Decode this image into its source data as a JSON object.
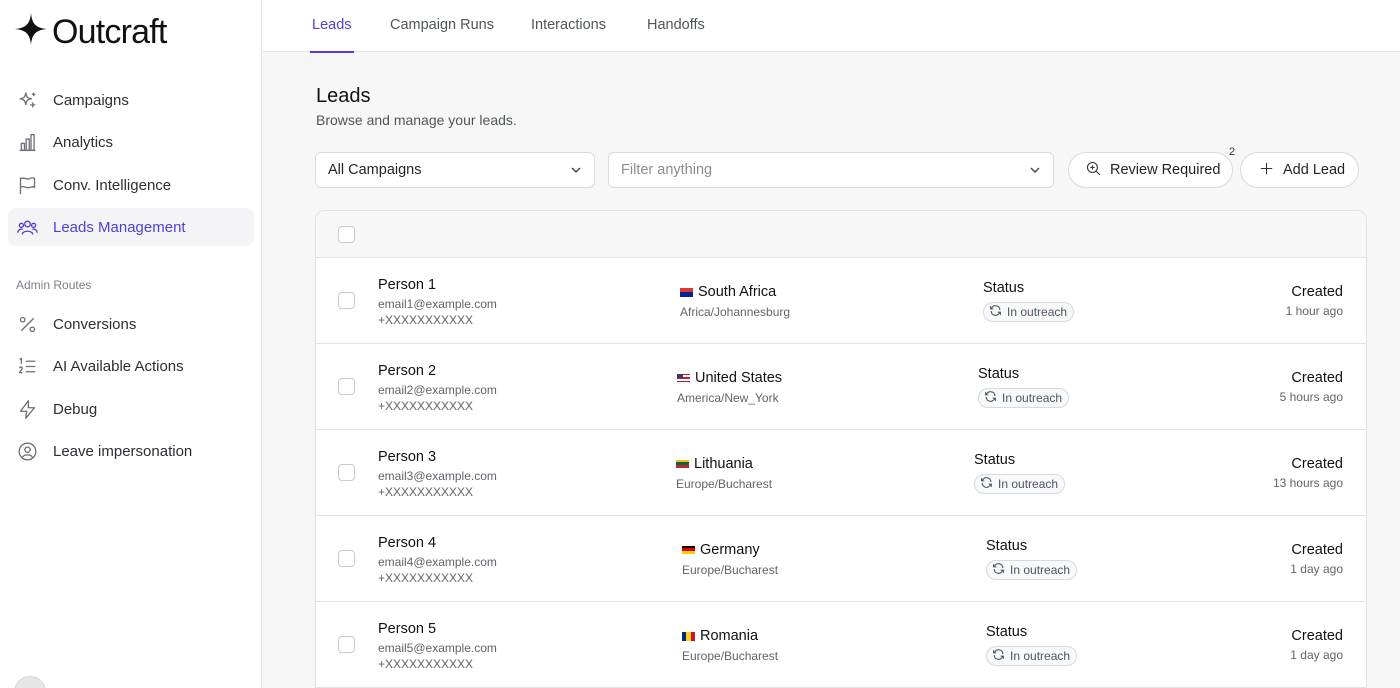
{
  "brand": {
    "name": "Outcraft"
  },
  "sidebar": {
    "items": [
      {
        "label": "Campaigns",
        "icon": "sparkles-icon"
      },
      {
        "label": "Analytics",
        "icon": "bar-chart-icon"
      },
      {
        "label": "Conv. Intelligence",
        "icon": "flag-icon"
      },
      {
        "label": "Leads Management",
        "icon": "users-icon",
        "active": true
      }
    ],
    "admin_section_label": "Admin Routes",
    "admin_items": [
      {
        "label": "Conversions",
        "icon": "percent-icon"
      },
      {
        "label": "AI Available Actions",
        "icon": "list-ordered-icon"
      },
      {
        "label": "Debug",
        "icon": "lightning-icon"
      },
      {
        "label": "Leave impersonation",
        "icon": "user-circle-icon"
      }
    ]
  },
  "tabs": [
    {
      "label": "Leads",
      "active": true
    },
    {
      "label": "Campaign Runs"
    },
    {
      "label": "Interactions"
    },
    {
      "label": "Handoffs"
    }
  ],
  "page": {
    "title": "Leads",
    "subtitle": "Browse and manage your leads."
  },
  "filters": {
    "campaign_select": "All Campaigns",
    "filter_placeholder": "Filter anything",
    "review_label": "Review Required",
    "review_count": "2",
    "add_label": "Add Lead"
  },
  "leads": [
    {
      "name": "Person 1",
      "email": "email1@example.com",
      "phone": "+XXXXXXXXXXX",
      "country": "South Africa",
      "flag": "za",
      "timezone": "Africa/Johannesburg",
      "status_label": "Status",
      "status": "In outreach",
      "created_label": "Created",
      "created": "1 hour ago"
    },
    {
      "name": "Person 2",
      "email": "email2@example.com",
      "phone": "+XXXXXXXXXXX",
      "country": "United States",
      "flag": "us",
      "timezone": "America/New_York",
      "status_label": "Status",
      "status": "In outreach",
      "created_label": "Created",
      "created": "5 hours ago"
    },
    {
      "name": "Person 3",
      "email": "email3@example.com",
      "phone": "+XXXXXXXXXXX",
      "country": "Lithuania",
      "flag": "lt",
      "timezone": "Europe/Bucharest",
      "status_label": "Status",
      "status": "In outreach",
      "created_label": "Created",
      "created": "13 hours ago"
    },
    {
      "name": "Person 4",
      "email": "email4@example.com",
      "phone": "+XXXXXXXXXXX",
      "country": "Germany",
      "flag": "de",
      "timezone": "Europe/Bucharest",
      "status_label": "Status",
      "status": "In outreach",
      "created_label": "Created",
      "created": "1 day ago"
    },
    {
      "name": "Person 5",
      "email": "email5@example.com",
      "phone": "+XXXXXXXXXXX",
      "country": "Romania",
      "flag": "ro",
      "timezone": "Europe/Bucharest",
      "status_label": "Status",
      "status": "In outreach",
      "created_label": "Created",
      "created": "1 day ago"
    }
  ],
  "colors": {
    "accent": "#4f3fd6",
    "border": "#e2e2e6",
    "muted_text": "#60646c"
  }
}
